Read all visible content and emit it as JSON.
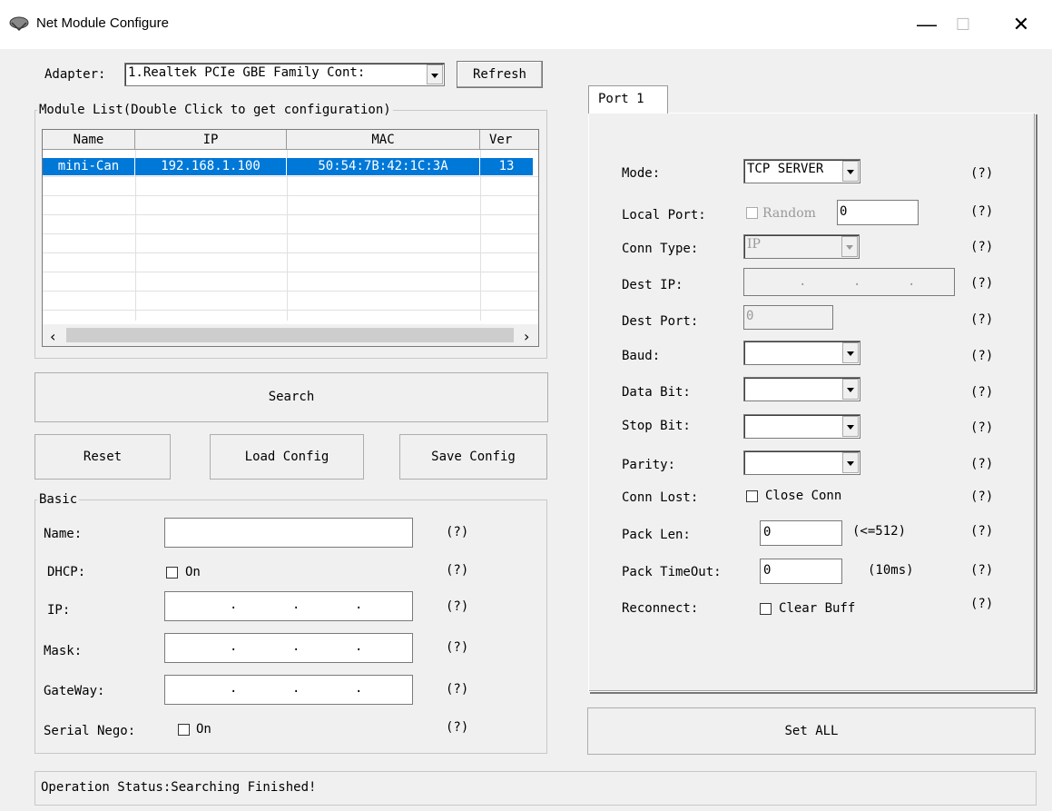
{
  "window": {
    "title": "Net Module Configure",
    "minimize_glyph": "—",
    "maximize_glyph": "☐",
    "close_glyph": "✕"
  },
  "adapter": {
    "label": "Adapter:",
    "selected": "1.Realtek PCIe GBE Family Cont:",
    "refresh_label": "Refresh"
  },
  "module_list": {
    "title": "Module List(Double Click to get configuration)",
    "columns": [
      "Name",
      "IP",
      "MAC",
      "Ver"
    ],
    "rows": [
      {
        "name": "mini-Can",
        "ip": "192.168.1.100",
        "mac": "50:54:7B:42:1C:3A",
        "ver": "13",
        "selected": true
      }
    ]
  },
  "actions": {
    "search_label": "Search",
    "reset_label": "Reset",
    "load_label": "Load Config",
    "save_label": "Save Config"
  },
  "basic": {
    "title": "Basic",
    "name_label": "Name:",
    "name_value": "",
    "dhcp_label": "DHCP:",
    "dhcp_on_label": "On",
    "dhcp_checked": false,
    "ip_label": "IP:",
    "mask_label": "Mask:",
    "gateway_label": "GateWay:",
    "serial_nego_label": "Serial Nego:",
    "serial_nego_on_label": "On",
    "serial_nego_checked": false,
    "help": "(?)"
  },
  "port": {
    "tab_label": "Port 1",
    "mode_label": "Mode:",
    "mode_value": "TCP SERVER",
    "local_port_label": "Local Port:",
    "random_label": "Random",
    "local_port_value": "0",
    "conn_type_label": "Conn Type:",
    "conn_type_value": "IP",
    "dest_ip_label": "Dest IP:",
    "dest_port_label": "Dest Port:",
    "dest_port_value": "0",
    "baud_label": "Baud:",
    "data_bit_label": "Data Bit:",
    "stop_bit_label": "Stop Bit:",
    "parity_label": "Parity:",
    "conn_lost_label": "Conn Lost:",
    "close_conn_label": "Close Conn",
    "pack_len_label": "Pack Len:",
    "pack_len_value": "0",
    "pack_len_hint": "(<=512)",
    "pack_timeout_label": "Pack TimeOut:",
    "pack_timeout_value": "0",
    "pack_timeout_hint": "(10ms)",
    "reconnect_label": "Reconnect:",
    "clear_buff_label": "Clear Buff",
    "help": "(?)"
  },
  "set_all_label": "Set ALL",
  "status": {
    "text": "Operation Status:Searching Finished!"
  },
  "colors": {
    "selection": "#0078d7",
    "window_bg": "#f0f0f0"
  }
}
